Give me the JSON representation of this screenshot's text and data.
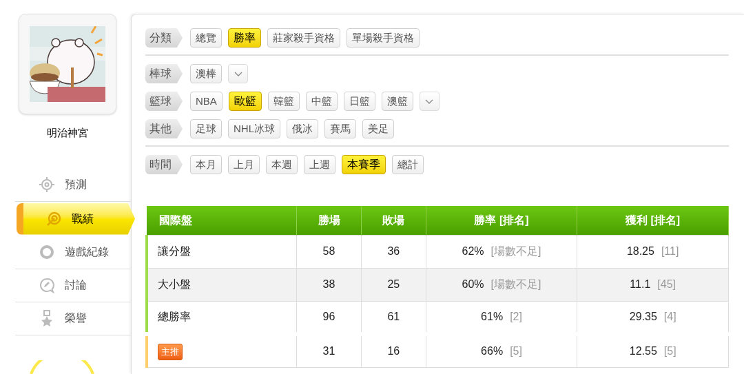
{
  "user": {
    "name": "明治神宮"
  },
  "nav": [
    {
      "label": "預測",
      "selected": false
    },
    {
      "label": "戰績",
      "selected": true
    },
    {
      "label": "遊戲紀錄",
      "selected": false
    },
    {
      "label": "討論",
      "selected": false
    },
    {
      "label": "榮譽",
      "selected": false
    }
  ],
  "filter_groups": [
    {
      "rows": [
        {
          "label": "分類",
          "has_more": false,
          "options": [
            {
              "label": "總覽",
              "selected": false
            },
            {
              "label": "勝率",
              "selected": true
            },
            {
              "label": "莊家殺手資格",
              "selected": false
            },
            {
              "label": "單場殺手資格",
              "selected": false
            }
          ]
        }
      ]
    },
    {
      "rows": [
        {
          "label": "棒球",
          "has_more": true,
          "options": [
            {
              "label": "澳棒",
              "selected": false
            }
          ]
        },
        {
          "label": "籃球",
          "has_more": true,
          "options": [
            {
              "label": "NBA",
              "selected": false
            },
            {
              "label": "歐籃",
              "selected": true
            },
            {
              "label": "韓籃",
              "selected": false
            },
            {
              "label": "中籃",
              "selected": false
            },
            {
              "label": "日籃",
              "selected": false
            },
            {
              "label": "澳籃",
              "selected": false
            }
          ]
        },
        {
          "label": "其他",
          "has_more": false,
          "options": [
            {
              "label": "足球",
              "selected": false
            },
            {
              "label": "NHL冰球",
              "selected": false
            },
            {
              "label": "俄冰",
              "selected": false
            },
            {
              "label": "賽馬",
              "selected": false
            },
            {
              "label": "美足",
              "selected": false
            }
          ]
        }
      ]
    },
    {
      "rows": [
        {
          "label": "時間",
          "has_more": false,
          "options": [
            {
              "label": "本月",
              "selected": false
            },
            {
              "label": "上月",
              "selected": false
            },
            {
              "label": "本週",
              "selected": false
            },
            {
              "label": "上週",
              "selected": false
            },
            {
              "label": "本賽季",
              "selected": true
            },
            {
              "label": "總計",
              "selected": false
            }
          ]
        }
      ]
    }
  ],
  "table": {
    "columns": [
      "國際盤",
      "勝場",
      "敗場",
      "勝率 [排名]",
      "獲利 [排名]"
    ],
    "rows": [
      {
        "kind": "normal",
        "name": "讓分盤",
        "wins": "58",
        "losses": "36",
        "rate": "62%",
        "rate_rank": "[場數不足]",
        "profit": "18.25",
        "profit_rank": "[11]"
      },
      {
        "kind": "normal",
        "name": "大小盤",
        "wins": "38",
        "losses": "25",
        "rate": "60%",
        "rate_rank": "[場數不足]",
        "profit": "11.1",
        "profit_rank": "[45]"
      },
      {
        "kind": "normal",
        "name": "總勝率",
        "wins": "96",
        "losses": "61",
        "rate": "61%",
        "rate_rank": "[2]",
        "profit": "29.35",
        "profit_rank": "[4]"
      },
      {
        "kind": "featured",
        "name": "主推",
        "wins": "31",
        "losses": "16",
        "rate": "66%",
        "rate_rank": "[5]",
        "profit": "12.55",
        "profit_rank": "[5]"
      }
    ]
  }
}
